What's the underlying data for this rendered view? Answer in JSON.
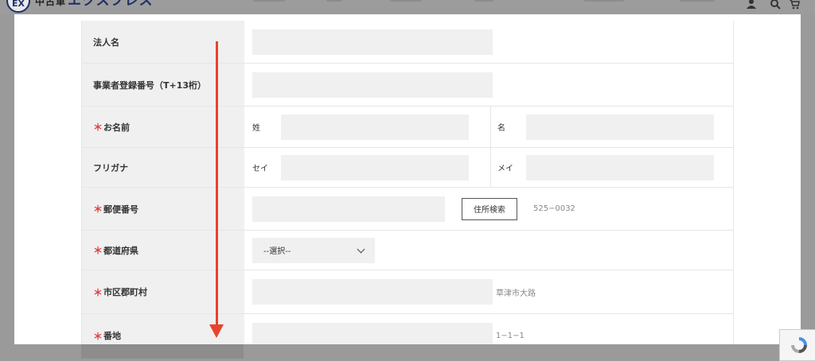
{
  "header": {
    "logo_mark": "EX",
    "logo_prefix": "中古車",
    "logo_name": "エクスプレス",
    "icons": [
      "user-icon",
      "search-icon",
      "cart-icon"
    ]
  },
  "form": {
    "rows": [
      {
        "label": "法人名",
        "required": false,
        "value": ""
      },
      {
        "label": "事業者登録番号（T+13桁）",
        "required": false,
        "value": ""
      },
      {
        "label": "お名前",
        "required": true,
        "last_label": "姓",
        "last_value": "",
        "first_label": "名",
        "first_value": ""
      },
      {
        "label": "フリガナ",
        "required": false,
        "last_label": "セイ",
        "last_value": "",
        "first_label": "メイ",
        "first_value": ""
      },
      {
        "label": "郵便番号",
        "required": true,
        "value": "",
        "button_label": "住所検索",
        "hint": "525−0032"
      },
      {
        "label": "都道府県",
        "required": true,
        "selected": "--選択--"
      },
      {
        "label": "市区郡町村",
        "required": true,
        "value": "",
        "hint": "草津市大路"
      },
      {
        "label": "番地",
        "required": true,
        "value": "",
        "hint": "1−1−1"
      }
    ],
    "required_mark": "＊"
  },
  "annotation": {
    "arrow_color": "#e8432f",
    "direction": "down"
  },
  "colors": {
    "label_bg": "#f0f0f0",
    "input_bg": "#f0f0f0",
    "required": "#e23b3b",
    "brand": "#1f2f6b"
  }
}
